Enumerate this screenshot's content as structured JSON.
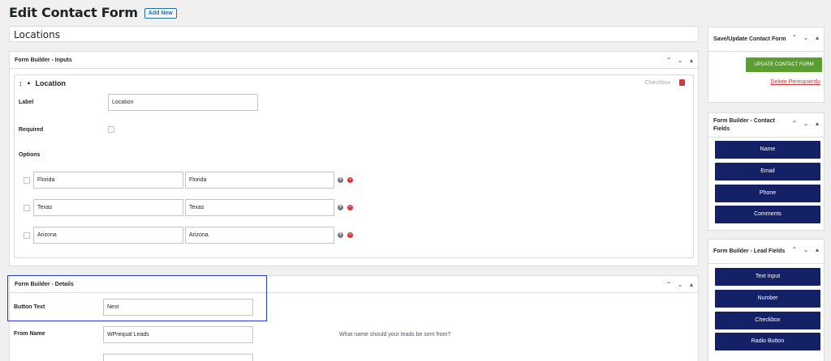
{
  "page": {
    "title": "Edit Contact Form",
    "add_new": "Add New"
  },
  "form_title": "Locations",
  "inputs_box": {
    "title": "Form Builder - Inputs",
    "field": {
      "name": "Location",
      "type": "Checkbox",
      "label_caption": "Label",
      "label_value": "Location",
      "required_caption": "Required",
      "options_caption": "Options",
      "options": [
        {
          "value": "Florida",
          "label": "Florida"
        },
        {
          "value": "Texas",
          "label": "Texas"
        },
        {
          "value": "Arizona",
          "label": "Arizona"
        }
      ]
    }
  },
  "details_box": {
    "title": "Form Builder - Details",
    "button_text_caption": "Button Text",
    "button_text_value": "Next",
    "from_name_caption": "From Name",
    "from_name_value": "WPrequal Leads",
    "from_name_help": "What name should your leads be sent from?"
  },
  "sidebar": {
    "save": {
      "title": "Save/Update Contact Form",
      "update_button": "UPDATE CONTACT FORM",
      "delete_link": "Delete Permanently"
    },
    "contact_fields": {
      "title": "Form Builder - Contact Fields",
      "buttons": [
        "Name",
        "Email",
        "Phone",
        "Comments"
      ]
    },
    "lead_fields": {
      "title": "Form Builder - Lead Fields",
      "buttons": [
        "Text Input",
        "Number",
        "Checkbox",
        "Radio Button"
      ]
    }
  },
  "colors": {
    "accent": "#2271b1",
    "button_navy": "#142166",
    "update_green": "#5a9e2f",
    "danger": "#d63638",
    "highlight": "#2a3dd6"
  }
}
